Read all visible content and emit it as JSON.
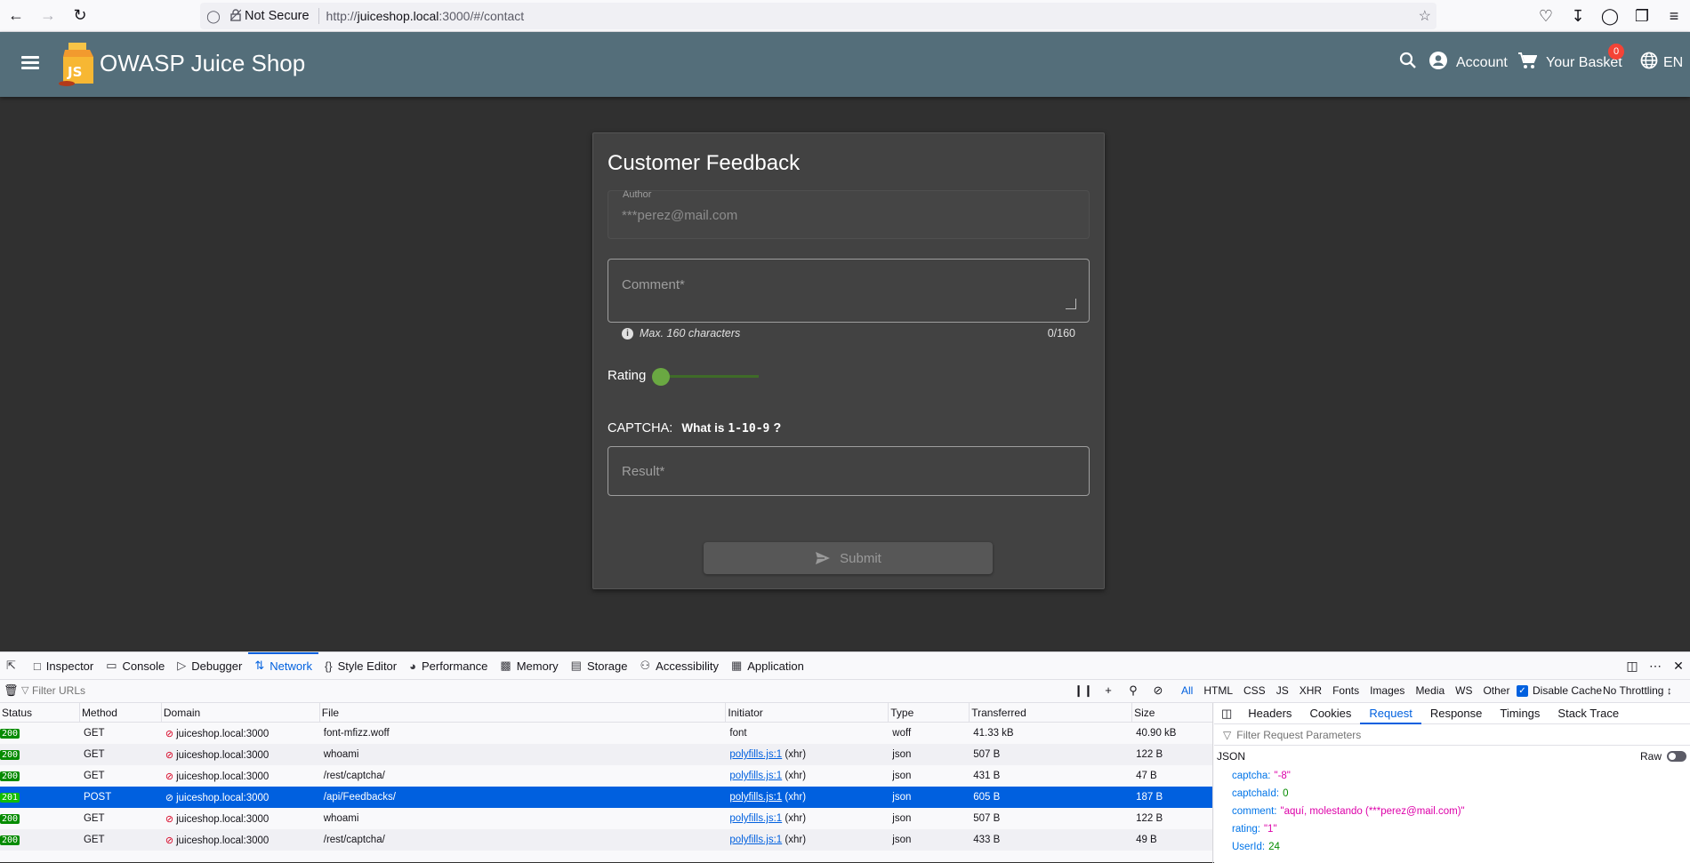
{
  "browser": {
    "not_secure": "Not Secure",
    "url_prefix": "http://",
    "url_host": "juiceshop.local",
    "url_rest": ":3000/#/contact"
  },
  "app": {
    "title": "OWASP Juice Shop",
    "account": "Account",
    "basket": "Your Basket",
    "basket_count": "0",
    "language": "EN"
  },
  "feedback": {
    "title": "Customer Feedback",
    "author_label": "Author",
    "author_value": "***perez@mail.com",
    "comment_placeholder": "Comment*",
    "hint": "Max. 160 characters",
    "counter": "0/160",
    "rating_label": "Rating",
    "rating_value": 1,
    "captcha_prefix": "CAPTCHA:",
    "captcha_what": "What is",
    "captcha_expr": "1-10-9",
    "captcha_q": "?",
    "result_placeholder": "Result*",
    "submit": "Submit"
  },
  "devtools": {
    "tabs": [
      "Inspector",
      "Console",
      "Debugger",
      "Network",
      "Style Editor",
      "Performance",
      "Memory",
      "Storage",
      "Accessibility",
      "Application"
    ],
    "active_tab": "Network",
    "filter_placeholder": "Filter URLs",
    "type_filters": [
      "All",
      "HTML",
      "CSS",
      "JS",
      "XHR",
      "Fonts",
      "Images",
      "Media",
      "WS",
      "Other"
    ],
    "disable_cache": "Disable Cache",
    "throttling": "No Throttling ↕",
    "columns": [
      "Status",
      "Method",
      "Domain",
      "File",
      "Initiator",
      "Type",
      "Transferred",
      "Size"
    ],
    "rows": [
      {
        "status": "200",
        "method": "GET",
        "domain": "juiceshop.local:3000",
        "file": "font-mfizz.woff",
        "initiator": "font",
        "init_link": "",
        "type": "woff",
        "transferred": "41.33 kB",
        "size": "40.90 kB"
      },
      {
        "status": "200",
        "method": "GET",
        "domain": "juiceshop.local:3000",
        "file": "whoami",
        "initiator": " (xhr)",
        "init_link": "polyfills.js:1",
        "type": "json",
        "transferred": "507 B",
        "size": "122 B"
      },
      {
        "status": "200",
        "method": "GET",
        "domain": "juiceshop.local:3000",
        "file": "/rest/captcha/",
        "initiator": " (xhr)",
        "init_link": "polyfills.js:1",
        "type": "json",
        "transferred": "431 B",
        "size": "47 B"
      },
      {
        "status": "201",
        "method": "POST",
        "domain": "juiceshop.local:3000",
        "file": "/api/Feedbacks/",
        "initiator": " (xhr)",
        "init_link": "polyfills.js:1",
        "type": "json",
        "transferred": "605 B",
        "size": "187 B"
      },
      {
        "status": "200",
        "method": "GET",
        "domain": "juiceshop.local:3000",
        "file": "whoami",
        "initiator": " (xhr)",
        "init_link": "polyfills.js:1",
        "type": "json",
        "transferred": "507 B",
        "size": "122 B"
      },
      {
        "status": "200",
        "method": "GET",
        "domain": "juiceshop.local:3000",
        "file": "/rest/captcha/",
        "initiator": " (xhr)",
        "init_link": "polyfills.js:1",
        "type": "json",
        "transferred": "433 B",
        "size": "49 B"
      }
    ],
    "side_tabs": [
      "Headers",
      "Cookies",
      "Request",
      "Response",
      "Timings",
      "Stack Trace"
    ],
    "active_side_tab": "Request",
    "param_filter": "Filter Request Parameters",
    "json_label": "JSON",
    "raw_label": "Raw",
    "json": [
      {
        "key": "captcha:",
        "value": "\"-8\"",
        "kind": "s"
      },
      {
        "key": "captchaId:",
        "value": "0",
        "kind": "n"
      },
      {
        "key": "comment:",
        "value": "\"aquí, molestando (***perez@mail.com)\"",
        "kind": "s"
      },
      {
        "key": "rating:",
        "value": "\"1\"",
        "kind": "s"
      },
      {
        "key": "UserId:",
        "value": "24",
        "kind": "n"
      }
    ]
  }
}
